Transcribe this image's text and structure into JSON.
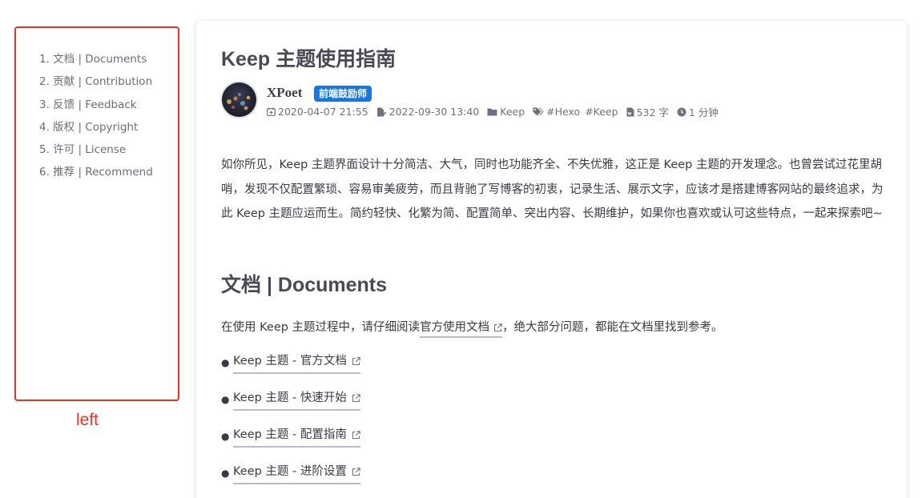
{
  "toc": {
    "items": [
      {
        "label": "1. 文档 | Documents"
      },
      {
        "label": "2. 贡献 | Contribution"
      },
      {
        "label": "3. 反馈 | Feedback"
      },
      {
        "label": "4. 版权 | Copyright"
      },
      {
        "label": "5. 许可 | License"
      },
      {
        "label": "6. 推荐 | Recommend"
      }
    ],
    "annotation_label": "left",
    "annotation_color": "#ea3323"
  },
  "post": {
    "title": "Keep 主题使用指南",
    "author": "XPoet",
    "badge": "前端鼓励师",
    "badge_color": "#1677e0",
    "meta": {
      "created": "2020-04-07 21:55",
      "updated": "2022-09-30 13:40",
      "category": "Keep",
      "tags": [
        "#Hexo",
        "#Keep"
      ],
      "word_count": "532 字",
      "read_time": "1 分钟"
    },
    "intro_paragraph": "如你所见，Keep 主题界面设计十分简洁、大气，同时也功能齐全、不失优雅，这正是 Keep 主题的开发理念。也曾尝试过花里胡哨，发现不仅配置繁琐、容易审美疲劳，而且背驰了写博客的初衷，记录生活、展示文字，应该才是搭建博客网站的最终追求，为此 Keep 主题应运而生。简约轻快、化繁为简、配置简单、突出内容、长期维护，如果你也喜欢或认可这些特点，一起来探索吧~",
    "section_heading": "文档 | Documents",
    "section_intro_before": "在使用 Keep 主题过程中，请仔细阅读",
    "section_intro_link": "官方使用文档",
    "section_intro_after": "，绝大部分问题，都能在文档里找到参考。",
    "doc_links": [
      {
        "label": "Keep 主题 - 官方文档"
      },
      {
        "label": "Keep 主题 - 快速开始"
      },
      {
        "label": "Keep 主题 - 配置指南"
      },
      {
        "label": "Keep 主题 - 进阶设置"
      }
    ]
  }
}
